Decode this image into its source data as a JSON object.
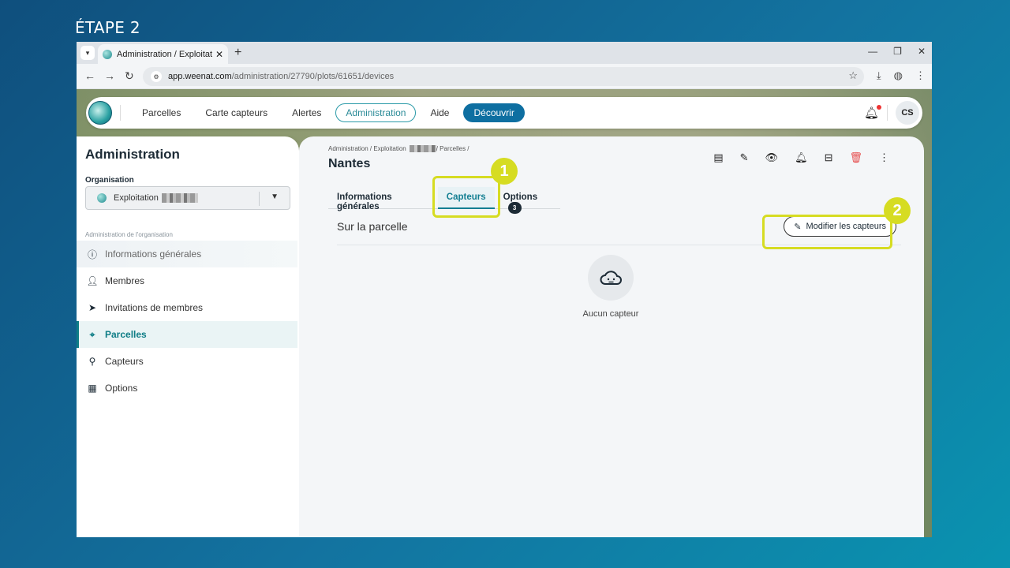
{
  "step_label": "ÉTAPE 2",
  "browser": {
    "tab_title": "Administration / Exploitation Sa...",
    "url_domain": "app.weenat.com",
    "url_path": "/administration/27790/plots/61651/devices"
  },
  "topnav": {
    "items": [
      "Parcelles",
      "Carte capteurs",
      "Alertes",
      "Administration",
      "Aide",
      "Découvrir"
    ],
    "avatar_initials": "CS"
  },
  "sidebar": {
    "title": "Administration",
    "org_label": "Organisation",
    "org_value": "Exploitation",
    "section_label": "Administration de l'organisation",
    "items": [
      {
        "label": "Informations générales",
        "icon": "info-icon"
      },
      {
        "label": "Membres",
        "icon": "person-icon"
      },
      {
        "label": "Invitations de membres",
        "icon": "send-icon"
      },
      {
        "label": "Parcelles",
        "icon": "map-pin-icon"
      },
      {
        "label": "Capteurs",
        "icon": "sensor-icon"
      },
      {
        "label": "Options",
        "icon": "grid-plus-icon"
      }
    ]
  },
  "main": {
    "breadcrumb": {
      "part1": "Administration",
      "part2": "Exploitation",
      "part3": "Parcelles"
    },
    "title": "Nantes",
    "tabs": [
      {
        "label": "Informations générales"
      },
      {
        "label": "Capteurs"
      },
      {
        "label": "Options",
        "badge": "3"
      }
    ],
    "section_title": "Sur la parcelle",
    "modify_button": "Modifier les capteurs",
    "empty_text": "Aucun capteur"
  },
  "highlights": [
    "1",
    "2"
  ],
  "colors": {
    "accent": "#0e7d86",
    "highlight": "#d6dc22",
    "discover": "#0e6fa1",
    "danger": "#e54b4b"
  }
}
